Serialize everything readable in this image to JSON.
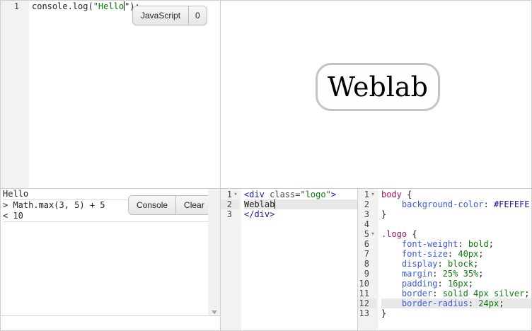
{
  "js_editor": {
    "line_numbers": [
      "1"
    ],
    "lines": [
      [
        {
          "t": "console.log(",
          "c": "tok-plain"
        },
        {
          "t": "\"Hello",
          "c": "tok-str"
        },
        {
          "t": "\");",
          "c": "tok-plain"
        }
      ]
    ],
    "language_button": "JavaScript",
    "count_button": "0"
  },
  "preview": {
    "logo_text": "Weblab"
  },
  "console": {
    "lines": [
      "Hello",
      "> Math.max(3, 5) + 5",
      "< 10"
    ],
    "console_button": "Console",
    "clear_button": "Clear"
  },
  "html_editor": {
    "line_numbers": [
      "1",
      "2",
      "3"
    ],
    "fold_markers": [
      "▾",
      "",
      ""
    ],
    "lines": [
      [
        {
          "t": "<div ",
          "c": "tok-tag"
        },
        {
          "t": "class=",
          "c": "tok-attr"
        },
        {
          "t": "\"logo\"",
          "c": "tok-str"
        },
        {
          "t": ">",
          "c": "tok-tag"
        }
      ],
      [
        {
          "t": "Weblab",
          "c": "tok-plain"
        }
      ],
      [
        {
          "t": "</div>",
          "c": "tok-tag"
        }
      ]
    ],
    "highlight_line": 2
  },
  "css_editor": {
    "line_numbers": [
      "1",
      "2",
      "3",
      "4",
      "5",
      "6",
      "7",
      "8",
      "9",
      "10",
      "11",
      "12",
      "13"
    ],
    "fold_markers": [
      "▾",
      "",
      "",
      "",
      "▾",
      "",
      "",
      "",
      "",
      "",
      "",
      "",
      ""
    ],
    "lines": [
      [
        {
          "t": "body",
          "c": "tok-kw"
        },
        {
          "t": " {",
          "c": "tok-plain"
        }
      ],
      [
        {
          "t": "    background-color",
          "c": "tok-prop"
        },
        {
          "t": ": ",
          "c": "tok-plain"
        },
        {
          "t": "#FEFEFE",
          "c": "tok-tag"
        },
        {
          "t": ";",
          "c": "tok-plain"
        }
      ],
      [
        {
          "t": "}",
          "c": "tok-plain"
        }
      ],
      [
        {
          "t": "",
          "c": "tok-plain"
        }
      ],
      [
        {
          "t": ".logo",
          "c": "tok-kw"
        },
        {
          "t": " {",
          "c": "tok-plain"
        }
      ],
      [
        {
          "t": "    font-weight",
          "c": "tok-prop"
        },
        {
          "t": ": ",
          "c": "tok-plain"
        },
        {
          "t": "bold",
          "c": "tok-val"
        },
        {
          "t": ";",
          "c": "tok-plain"
        }
      ],
      [
        {
          "t": "    font-size",
          "c": "tok-prop"
        },
        {
          "t": ": ",
          "c": "tok-plain"
        },
        {
          "t": "40px",
          "c": "tok-num"
        },
        {
          "t": ";",
          "c": "tok-plain"
        }
      ],
      [
        {
          "t": "    display",
          "c": "tok-prop"
        },
        {
          "t": ": ",
          "c": "tok-plain"
        },
        {
          "t": "block",
          "c": "tok-val"
        },
        {
          "t": ";",
          "c": "tok-plain"
        }
      ],
      [
        {
          "t": "    margin",
          "c": "tok-prop"
        },
        {
          "t": ": ",
          "c": "tok-plain"
        },
        {
          "t": "25% 35%",
          "c": "tok-num"
        },
        {
          "t": ";",
          "c": "tok-plain"
        }
      ],
      [
        {
          "t": "    padding",
          "c": "tok-prop"
        },
        {
          "t": ": ",
          "c": "tok-plain"
        },
        {
          "t": "16px",
          "c": "tok-num"
        },
        {
          "t": ";",
          "c": "tok-plain"
        }
      ],
      [
        {
          "t": "    border",
          "c": "tok-prop"
        },
        {
          "t": ": ",
          "c": "tok-plain"
        },
        {
          "t": "solid 4px silver",
          "c": "tok-val"
        },
        {
          "t": ";",
          "c": "tok-plain"
        }
      ],
      [
        {
          "t": "    border-radius",
          "c": "tok-prop"
        },
        {
          "t": ": ",
          "c": "tok-plain"
        },
        {
          "t": "24px",
          "c": "tok-num"
        },
        {
          "t": ";",
          "c": "tok-plain"
        }
      ],
      [
        {
          "t": "}",
          "c": "tok-plain"
        }
      ]
    ],
    "highlight_line": 12
  }
}
